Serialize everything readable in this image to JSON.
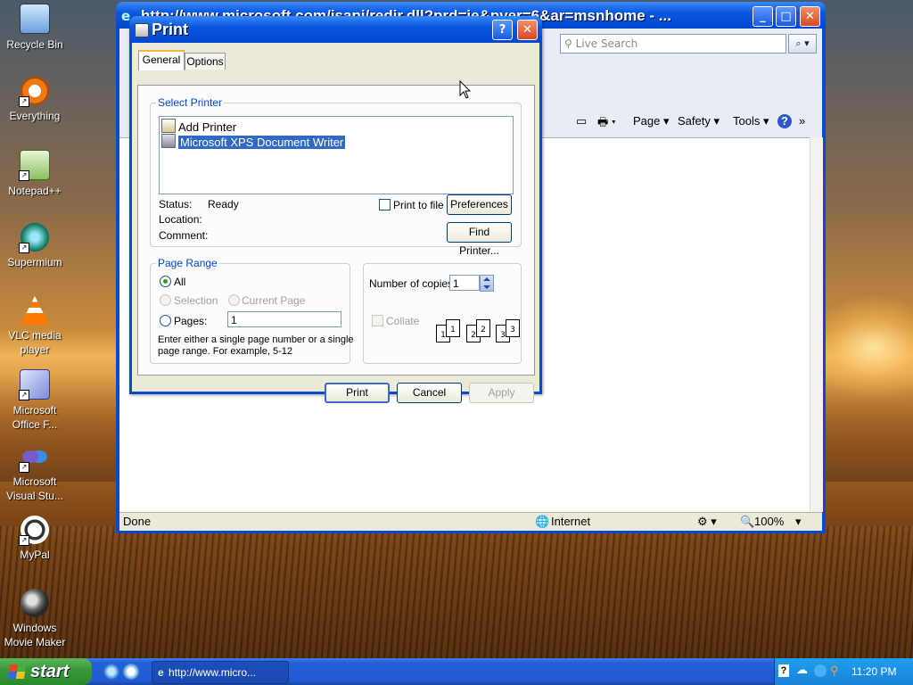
{
  "desktop": {
    "icons": [
      {
        "label": "Recycle Bin"
      },
      {
        "label": "Everything"
      },
      {
        "label": "Notepad++"
      },
      {
        "label": "Supermium"
      },
      {
        "label": "VLC media player"
      },
      {
        "label": "Microsoft Office F..."
      },
      {
        "label": "Microsoft Visual Stu..."
      },
      {
        "label": "MyPal"
      },
      {
        "label": "Windows Movie Maker"
      }
    ]
  },
  "ie": {
    "title": "http://www.microsoft.com/isapi/redir.dll?prd=ie&pver=6&ar=msnhome - ...",
    "search_placeholder": "Live Search",
    "commands": {
      "page": "Page",
      "safety": "Safety",
      "tools": "Tools"
    },
    "status": {
      "left": "Done",
      "zone": "Internet",
      "zoom": "100%"
    }
  },
  "dialog": {
    "title": "Print",
    "tabs": [
      "General",
      "Options"
    ],
    "select_printer_label": "Select Printer",
    "printers": [
      "Add Printer",
      "Microsoft XPS Document Writer"
    ],
    "status_label": "Status:",
    "status_value": "Ready",
    "location_label": "Location:",
    "comment_label": "Comment:",
    "print_to_file_label": "Print to file",
    "preferences_button": "Preferences",
    "find_printer_button": "Find Printer...",
    "page_range": {
      "label": "Page Range",
      "all": "All",
      "selection": "Selection",
      "current_page": "Current Page",
      "pages": "Pages:",
      "pages_value": "1",
      "hint_line1": "Enter either a single page number or a single",
      "hint_line2": "page range.  For example, 5-12"
    },
    "copies": {
      "label": "Number of copies:",
      "value": "1",
      "collate": "Collate",
      "icons": [
        "1",
        "1",
        "2",
        "2",
        "3",
        "3"
      ]
    },
    "buttons": {
      "print": "Print",
      "cancel": "Cancel",
      "apply": "Apply"
    }
  },
  "taskbar": {
    "start": "start",
    "task_label": "http://www.micro...",
    "clock": "11:20 PM"
  }
}
